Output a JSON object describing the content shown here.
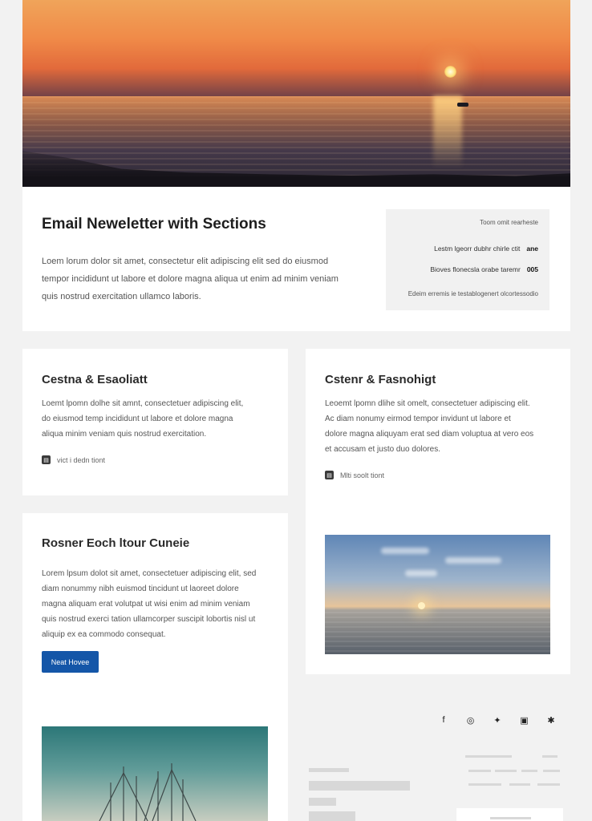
{
  "intro": {
    "title": "Email Neweletter with Sections",
    "body": "Loem lorum dolor sit amet, consectetur elit adipiscing elit sed do eiusmod tempor incididunt ut labore et dolore magna aliqua ut enim ad minim veniam quis nostrud exercitation ullamco laboris."
  },
  "summary": {
    "heading": "Toom omit rearheste",
    "rows": [
      {
        "label": "Lestm lgeorr dubhr chirle ctit",
        "value": "ane"
      },
      {
        "label": "Bioves flonecsla orabe taremr",
        "value": "005"
      }
    ],
    "footer": "Edeim erremis ie testablogenert olcortessodio"
  },
  "sections": [
    {
      "title": "Cestna & Esaoliatt",
      "body": "Loemt lpomn dolhe sit amnt, consectetuer adipiscing elit, do eiusmod temp incididunt ut labore et dolore magna aliqua minim veniam quis nostrud exercitation.",
      "link_label": "vict i dedn tiont"
    },
    {
      "title": "Cstenr & Fasnohigt",
      "body": "Leoemt lpomn dlihe sit omelt, consectetuer adipiscing elit. Ac diam nonumy eirmod tempor invidunt ut labore et dolore magna aliquyam erat sed diam voluptua at vero eos et accusam et justo duo dolores.",
      "link_label": "Mlti soolt tiont"
    },
    {
      "title": "Rosner Eoch ltour Cuneie",
      "body": "Lorem lpsum dolot sit amet, consectetuer adipiscing elit, sed diam nonummy nibh euismod tincidunt ut laoreet dolore magna aliquam erat volutpat ut wisi enim ad minim veniam quis nostrud exerci tation ullamcorper suscipit lobortis nisl ut aliquip ex ea commodo consequat.",
      "button_label": "Neat Hovee"
    }
  ],
  "footer": {
    "social": [
      {
        "icon": "facebook-icon",
        "glyph": "f"
      },
      {
        "icon": "instagram-icon",
        "glyph": "◎"
      },
      {
        "icon": "twitter-icon",
        "glyph": "✦"
      },
      {
        "icon": "youtube-icon",
        "glyph": "▣"
      },
      {
        "icon": "star-icon",
        "glyph": "✱"
      }
    ]
  },
  "colors": {
    "background": "#f2f2f2",
    "card": "#ffffff",
    "button": "#1456a8",
    "summary_bg": "#f1f1f1"
  }
}
